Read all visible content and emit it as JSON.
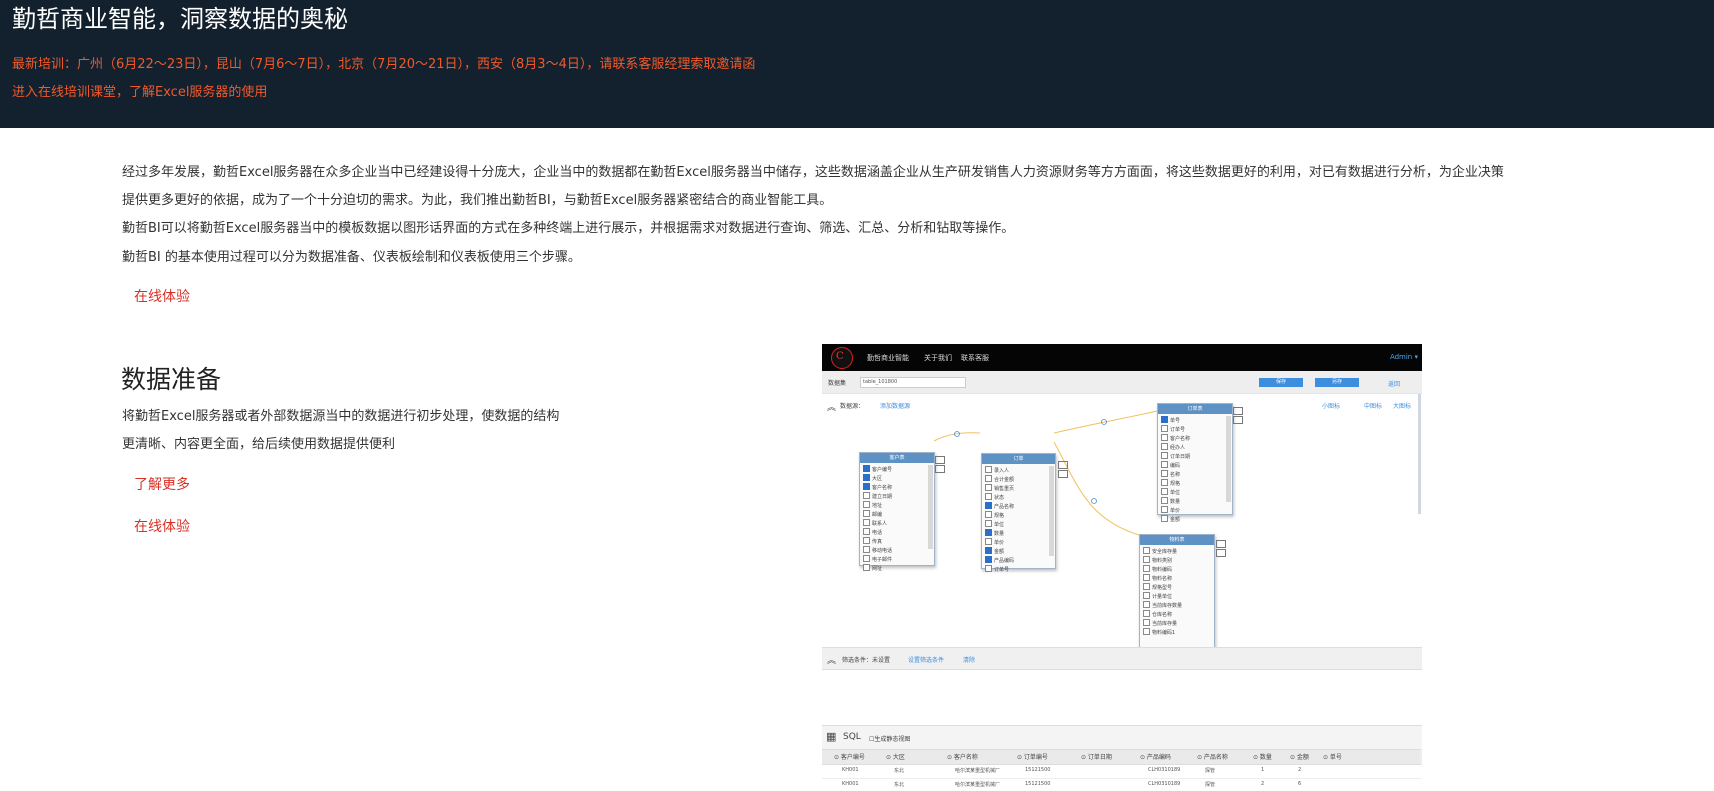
{
  "banner": {
    "title": "勤哲商业智能，洞察数据的奥秘",
    "training": "最新培训：广州（6月22～23日），昆山（7月6～7日），北京（7月20～21日），西安（8月3～4日），请联系客服经理索取邀请函",
    "course_link": "进入在线培训课堂，了解Excel服务器的使用"
  },
  "intro": {
    "p1_line1": "经过多年发展，勤哲Excel服务器在众多企业当中已经建设得十分庞大，企业当中的数据都在勤哲Excel服务器当中储存，这些数据涵盖企业从生产研发销售人力资源财务等方方面面，将这些数据更好的利用，对已有数据进行分析，为企业决策",
    "p1_line2": "提供更多更好的依据，成为了一个十分迫切的需求。为此，我们推出勤哲BI，与勤哲Excel服务器紧密结合的商业智能工具。",
    "p2": "勤哲BI可以将勤哲Excel服务器当中的模板数据以图形话界面的方式在多种终端上进行展示，并根据需求对数据进行查询、筛选、汇总、分析和钻取等操作。",
    "p3": "勤哲BI 的基本使用过程可以分为数据准备、仪表板绘制和仪表板使用三个步骤。",
    "try_link": "在线体验"
  },
  "section": {
    "title": "数据准备",
    "desc_line1": "将勤哲Excel服务器或者外部数据源当中的数据进行初步处理，使数据的结构",
    "desc_line2": "更清晰、内容更全面，给后续使用数据提供便利",
    "learn_more": "了解更多",
    "try_link": "在线体验"
  },
  "screenshot": {
    "nav": {
      "logo": "C",
      "items": [
        "勤哲商业智能",
        "关于我们",
        "联系客服"
      ],
      "admin": "Admin ▾"
    },
    "toolbar": {
      "dataset_label": "数据集",
      "dataset_value": "table_101800",
      "save": "保存",
      "save2": "另存",
      "back": "返回"
    },
    "source": {
      "label": "数据源：",
      "add": "添加数据源",
      "r1": "小图标",
      "r2": "中图标",
      "r3": "大图标"
    },
    "tables": [
      {
        "name": "客户表",
        "fields": [
          [
            "客户编号",
            true
          ],
          [
            "大区",
            true
          ],
          [
            "客户名称",
            true
          ],
          [
            "建立日期",
            false
          ],
          [
            "地址",
            false
          ],
          [
            "邮编",
            false
          ],
          [
            "联系人",
            false
          ],
          [
            "电话",
            false
          ],
          [
            "传真",
            false
          ],
          [
            "移动电话",
            false
          ],
          [
            "电子邮件",
            false
          ],
          [
            "网址",
            false
          ]
        ]
      },
      {
        "name": "订单",
        "fields": [
          [
            "录入人",
            false
          ],
          [
            "合计金额",
            false
          ],
          [
            "销售重页",
            false
          ],
          [
            "状态",
            false
          ],
          [
            "产品名称",
            true
          ],
          [
            "规格",
            false
          ],
          [
            "单位",
            false
          ],
          [
            "数量",
            true
          ],
          [
            "单价",
            false
          ],
          [
            "金额",
            true
          ],
          [
            "产品编码",
            true
          ],
          [
            "订单号",
            false
          ]
        ]
      },
      {
        "name": "订单表",
        "fields": [
          [
            "单号",
            true
          ],
          [
            "订单号",
            false
          ],
          [
            "客户名称",
            false
          ],
          [
            "经办人",
            false
          ],
          [
            "订单日期",
            false
          ],
          [
            "编码",
            false
          ],
          [
            "名称",
            false
          ],
          [
            "规格",
            false
          ],
          [
            "单位",
            false
          ],
          [
            "数量",
            false
          ],
          [
            "单价",
            false
          ],
          [
            "金额",
            false
          ]
        ]
      },
      {
        "name": "物料表",
        "fields": [
          [
            "安全库存量",
            false
          ],
          [
            "物料类别",
            false
          ],
          [
            "物料编码",
            false
          ],
          [
            "物料名称",
            false
          ],
          [
            "规格型号",
            false
          ],
          [
            "计量单位",
            false
          ],
          [
            "当前库存数量",
            false
          ],
          [
            "仓库名称",
            false
          ],
          [
            "当前库存量",
            false
          ],
          [
            "物料编码1",
            false
          ]
        ]
      }
    ],
    "filter": {
      "label": "筛选条件：未设置",
      "set": "设置筛选条件",
      "clear": "清除"
    },
    "sql": {
      "label": "SQL",
      "check": "生成静态视图"
    },
    "columns": [
      "客户编号",
      "大区",
      "客户名称",
      "订单编号",
      "订单日期",
      "产品编码",
      "产品名称",
      "数量",
      "金额",
      "单号"
    ],
    "rows": [
      [
        "KH001",
        "东北",
        "哈尔滨某重型机械厂",
        "15121500",
        "",
        "CLH0310189",
        "探管",
        "1",
        "2",
        ""
      ],
      [
        "KH001",
        "东北",
        "哈尔滨某重型机械厂",
        "15121500",
        "",
        "CLH0310189",
        "探管",
        "2",
        "6",
        ""
      ]
    ]
  }
}
